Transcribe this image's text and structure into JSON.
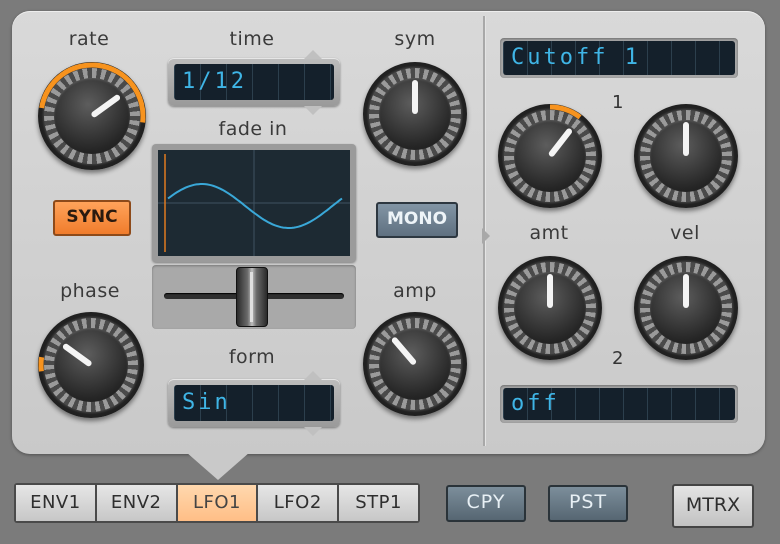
{
  "left": {
    "rate_label": "rate",
    "time_label": "time",
    "time_value": "1/12",
    "sym_label": "sym",
    "fade_in_label": "fade in",
    "sync_button": "SYNC",
    "mono_button": "MONO",
    "phase_label": "phase",
    "amp_label": "amp",
    "form_label": "form",
    "form_value": "Sin"
  },
  "right": {
    "target1_value": "Cutoff 1",
    "slot1_number": "1",
    "amt_label": "amt",
    "vel_label": "vel",
    "slot2_number": "2",
    "target2_value": "off"
  },
  "tabs": [
    {
      "label": "ENV1",
      "active": false
    },
    {
      "label": "ENV2",
      "active": false
    },
    {
      "label": "LFO1",
      "active": true
    },
    {
      "label": "LFO2",
      "active": false
    },
    {
      "label": "STP1",
      "active": false
    }
  ],
  "buttons": {
    "copy": "CPY",
    "paste": "PST",
    "matrix": "MTRX"
  },
  "colors": {
    "accent_orange": "#f7931e",
    "lcd_text": "#3fb5e6",
    "wave_line": "#3aa8d8"
  },
  "knob_positions": {
    "rate": 0.7,
    "sym": 0.5,
    "phase": 0.3,
    "amp": 0.35,
    "amt_1": 0.64,
    "vel_1": 0.5,
    "amt_2": 0.5,
    "vel_2": 0.5
  }
}
